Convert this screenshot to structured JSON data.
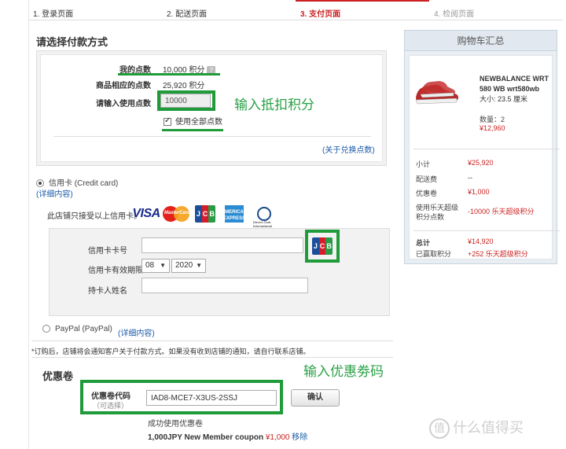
{
  "steps": [
    "1. 登录页面",
    "2. 配送页面",
    "3. 支付页面",
    "4. 检阅页面"
  ],
  "payment": {
    "title": "请选择付款方式",
    "points": {
      "my_points_label": "我的点数",
      "my_points_value": "10,000 积分",
      "qmark": "?",
      "eq_points_label": "商品相应的点数",
      "eq_points_value": "25,920 积分",
      "use_points_label": "请输入使用点数",
      "use_points_value": "10000",
      "use_all_label": "使用全部点数",
      "about_link": "(关于兑换点数)"
    },
    "credit_card": {
      "label": "信用卡 (Credit card)",
      "detail_link": "(详细内容)",
      "accept_text": "此店铺只接受以上信用卡。",
      "card_number_label": "信用卡卡号",
      "expiry_label": "信用卡有效期限",
      "expiry_month": "08",
      "expiry_year": "2020",
      "holder_label": "持卡人姓名",
      "logos": {
        "visa": "VISA",
        "mastercard": "MasterCard",
        "jcb": [
          "J",
          "C",
          "B"
        ],
        "amex": "AMERICAN EXPRESS",
        "diners": "Diners Club International"
      }
    },
    "paypal": {
      "label": "PayPal (PayPal)",
      "detail_link": "(详细内容)"
    },
    "notice": "*订购后，店铺将会通知客户关于付款方式。如果没有收到店铺的通知，请自行联系店铺。"
  },
  "coupon": {
    "title": "优惠卷",
    "code_label": "优惠卷代码",
    "optional": "（可选择）",
    "code_value": "IAD8-MCE7-X3US-2SSJ",
    "confirm_button": "确认",
    "success_text": "成功使用优惠卷",
    "item_name": "1,000JPY New Member coupon",
    "item_price": "¥1,000",
    "remove_link": "移除"
  },
  "annotations": {
    "points_note": "输入抵扣积分",
    "coupon_note": "输入优惠劵码"
  },
  "cart": {
    "title": "购物车汇总",
    "product_name": "NEWBALANCE WRT 580 WB wrt580wb",
    "size": "大小: 23.5 厘米",
    "qty": "数量：2",
    "price": "¥12,960",
    "subtotal_label": "小计",
    "subtotal_value": "¥25,920",
    "shipping_label": "配送费",
    "shipping_value": "--",
    "coupon_label": "优惠卷",
    "coupon_value": "¥1,000",
    "points_used_label": "使用乐天超级积分点数",
    "points_used_value": "-10000 乐天超级积分",
    "total_label": "总计",
    "total_value": "¥14,920",
    "earned_label": "已赢取积分",
    "earned_value": "+252 乐天超级积分"
  },
  "watermark": {
    "glyph": "值",
    "text": "什么值得买"
  },
  "colors": {
    "accent_red": "#cc2222",
    "link_blue": "#1a5aa8",
    "annotation_green": "#1f9b3a"
  }
}
